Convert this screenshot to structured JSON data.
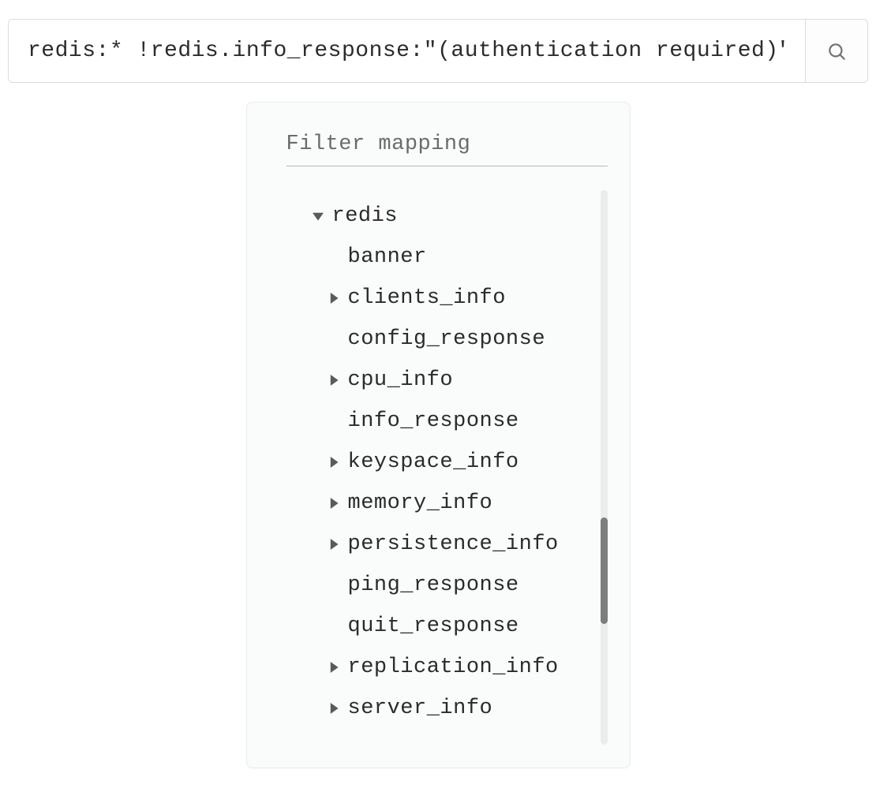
{
  "search": {
    "value": "redis:* !redis.info_response:\"(authentication required)\""
  },
  "panel": {
    "title": "Filter mapping"
  },
  "tree": {
    "root": "redis",
    "nodes": [
      {
        "label": "banner",
        "expandable": false
      },
      {
        "label": "clients_info",
        "expandable": true
      },
      {
        "label": "config_response",
        "expandable": false
      },
      {
        "label": "cpu_info",
        "expandable": true
      },
      {
        "label": "info_response",
        "expandable": false
      },
      {
        "label": "keyspace_info",
        "expandable": true
      },
      {
        "label": "memory_info",
        "expandable": true
      },
      {
        "label": "persistence_info",
        "expandable": true
      },
      {
        "label": "ping_response",
        "expandable": false
      },
      {
        "label": "quit_response",
        "expandable": false
      },
      {
        "label": "replication_info",
        "expandable": true
      },
      {
        "label": "server_info",
        "expandable": true
      }
    ]
  }
}
